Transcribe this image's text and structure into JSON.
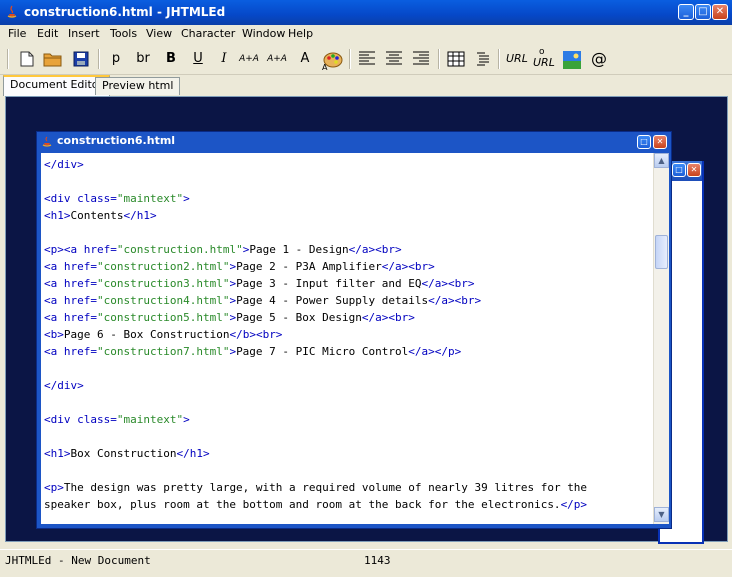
{
  "window": {
    "title": "construction6.html - JHTMLEd"
  },
  "menu": [
    "File",
    "Edit",
    "Insert",
    "Tools",
    "View",
    "Character",
    "Window",
    "Help"
  ],
  "toolbar": {
    "p": "p",
    "br": "br",
    "bold": "B",
    "underline": "U",
    "italic": "I",
    "font_bigger": "A+A",
    "font_smaller": "A+A",
    "font": "A",
    "url": "URL",
    "url_anchor": "URL",
    "email": "@"
  },
  "tabs": [
    "Document Editor",
    "Preview html"
  ],
  "doc": {
    "title": "construction6.html"
  },
  "code_lines": [
    [
      [
        "tag",
        "</div>"
      ]
    ],
    [],
    [
      [
        "tag",
        "<div class="
      ],
      [
        "str",
        "\"maintext\""
      ],
      [
        "tag",
        ">"
      ]
    ],
    [
      [
        "tag",
        "<h1>"
      ],
      [
        "txt",
        "Contents"
      ],
      [
        "tag",
        "</h1>"
      ]
    ],
    [],
    [
      [
        "tag",
        "<p><a href="
      ],
      [
        "str",
        "\"construction.html\""
      ],
      [
        "tag",
        ">"
      ],
      [
        "txt",
        "Page 1 - Design"
      ],
      [
        "tag",
        "</a><br>"
      ]
    ],
    [
      [
        "tag",
        "<a href="
      ],
      [
        "str",
        "\"construction2.html\""
      ],
      [
        "tag",
        ">"
      ],
      [
        "txt",
        "Page 2 - P3A Amplifier"
      ],
      [
        "tag",
        "</a><br>"
      ]
    ],
    [
      [
        "tag",
        "<a href="
      ],
      [
        "str",
        "\"construction3.html\""
      ],
      [
        "tag",
        ">"
      ],
      [
        "txt",
        "Page 3 - Input filter and EQ"
      ],
      [
        "tag",
        "</a><br>"
      ]
    ],
    [
      [
        "tag",
        "<a href="
      ],
      [
        "str",
        "\"construction4.html\""
      ],
      [
        "tag",
        ">"
      ],
      [
        "txt",
        "Page 4 - Power Supply details"
      ],
      [
        "tag",
        "</a><br>"
      ]
    ],
    [
      [
        "tag",
        "<a href="
      ],
      [
        "str",
        "\"construction5.html\""
      ],
      [
        "tag",
        ">"
      ],
      [
        "txt",
        "Page 5 - Box Design"
      ],
      [
        "tag",
        "</a><br>"
      ]
    ],
    [
      [
        "tag",
        "<b>"
      ],
      [
        "txt",
        "Page 6 - Box Construction"
      ],
      [
        "tag",
        "</b><br>"
      ]
    ],
    [
      [
        "tag",
        "<a href="
      ],
      [
        "str",
        "\"construction7.html\""
      ],
      [
        "tag",
        ">"
      ],
      [
        "txt",
        "Page 7 - PIC Micro Control"
      ],
      [
        "tag",
        "</a></p>"
      ]
    ],
    [],
    [
      [
        "tag",
        "</div>"
      ]
    ],
    [],
    [
      [
        "tag",
        "<div class="
      ],
      [
        "str",
        "\"maintext\""
      ],
      [
        "tag",
        ">"
      ]
    ],
    [],
    [
      [
        "tag",
        "<h1>"
      ],
      [
        "txt",
        "Box Construction"
      ],
      [
        "tag",
        "</h1>"
      ]
    ],
    [],
    [
      [
        "tag",
        "<p>"
      ],
      [
        "txt",
        "The design was pretty large, with a required volume of nearly 39 litres for the"
      ]
    ],
    [
      [
        "txt",
        "speaker box, plus room at the bottom and room at the back for the electronics."
      ],
      [
        "tag",
        "</p>"
      ]
    ]
  ],
  "status": {
    "left": "JHTMLEd - New Document",
    "count": "1143"
  },
  "colors": {
    "tag": "#0000c0",
    "string": "#2a8a2a",
    "desktop": "#0b1545",
    "titlebar": "#0648c8"
  }
}
